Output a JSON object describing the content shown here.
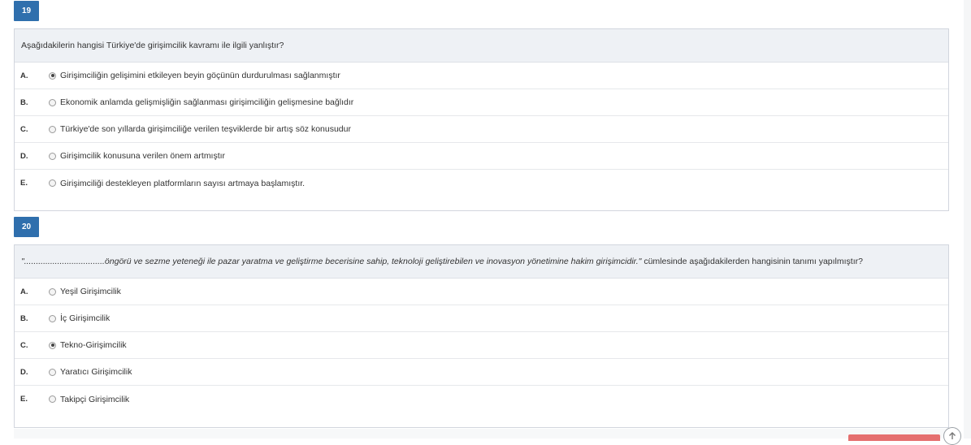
{
  "questions": [
    {
      "number": "19",
      "text": "Aşağıdakilerin hangisi Türkiye'de girişimcilik kavramı ile ilgili yanlıştır?",
      "selected": "A",
      "options": [
        {
          "letter": "A.",
          "text": "Girişimciliğin gelişimini etkileyen beyin göçünün durdurulması sağlanmıştır"
        },
        {
          "letter": "B.",
          "text": "Ekonomik anlamda gelişmişliğin sağlanması girişimciliğin gelişmesine bağlıdır"
        },
        {
          "letter": "C.",
          "text": "Türkiye'de son yıllarda girişimciliğe verilen teşviklerde bir artış söz konusudur"
        },
        {
          "letter": "D.",
          "text": "Girişimcilik konusuna verilen önem artmıştır"
        },
        {
          "letter": "E.",
          "text": "Girişimciliği destekleyen platformların sayısı artmaya başlamıştır."
        }
      ]
    },
    {
      "number": "20",
      "text_prefix": "\"..................................",
      "text_italic": "öngörü ve sezme yeteneği ile pazar yaratma ve geliştirme becerisine sahip, teknoloji geliştirebilen ve inovasyon yönetimine hakim girişimcidir.\"",
      "text_suffix": " cümlesinde aşağıdakilerden hangisinin tanımı yapılmıştır?",
      "selected": "C",
      "options": [
        {
          "letter": "A.",
          "text": "Yeşil Girişimcilik"
        },
        {
          "letter": "B.",
          "text": "İç Girişimcilik"
        },
        {
          "letter": "C.",
          "text": "Tekno-Girişimcilik"
        },
        {
          "letter": "D.",
          "text": "Yaratıcı Girişimcilik"
        },
        {
          "letter": "E.",
          "text": "Takipçi Girişimcilik"
        }
      ]
    }
  ],
  "icons": {
    "scroll_top": "arrow-up-circle-icon"
  },
  "colors": {
    "question_badge": "#2f6fad",
    "question_header_bg": "#eef1f5",
    "footer_button": "#e56f6f"
  }
}
